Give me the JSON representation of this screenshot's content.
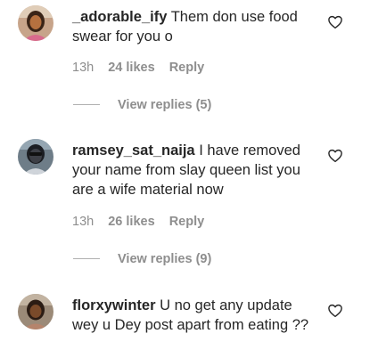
{
  "comments": [
    {
      "username": "_adorable_ify",
      "text": "Them don use food swear for you o",
      "time": "13h",
      "likes": "24 likes",
      "reply": "Reply",
      "view_replies": "View replies (5)",
      "avatar_colors": {
        "bg": "#c7a48a",
        "hair": "#3a2417",
        "skin": "#b6713f",
        "shirt": "#d86a8d"
      }
    },
    {
      "username": "ramsey_sat_naija",
      "text": "I have removed your name from slay queen list you are a wife material now",
      "time": "13h",
      "likes": "26 likes",
      "reply": "Reply",
      "view_replies": "View replies (9)",
      "avatar_colors": {
        "bg": "#6e7d88",
        "hair": "#1b1d22",
        "skin": "#3d3f46",
        "shirt": "#cfd4da"
      }
    },
    {
      "username": "florxywinter",
      "text": "U no get any update wey u Dey post apart from eating ??",
      "avatar_colors": {
        "bg": "#9b8a78",
        "hair": "#2b1c14",
        "skin": "#7a4a2a",
        "shirt": "#b5846c"
      }
    }
  ],
  "colors": {
    "text": "#262626",
    "muted": "#8e8e8e"
  },
  "icons": {
    "like": "heart-outline-icon"
  }
}
